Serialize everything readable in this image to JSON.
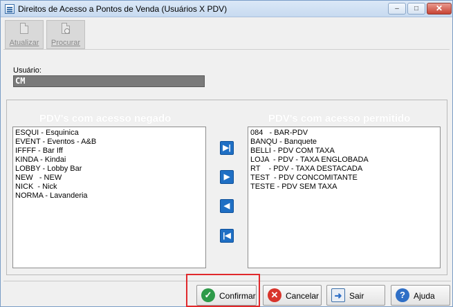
{
  "window": {
    "title": "Direitos de Acesso a Pontos de Venda  (Usuários X PDV)",
    "minimize": "‒",
    "maximize": "□",
    "close": "✕"
  },
  "toolbar": {
    "atualizar_label": "Atualizar",
    "procurar_label": "Procurar"
  },
  "user": {
    "label": "Usuário:",
    "value": "CM"
  },
  "denied": {
    "title": "PDV's com acesso negado",
    "items": [
      "ESQUI - Esquinica",
      "EVENT - Eventos - A&B",
      "IFFFF - Bar Iff",
      "KINDA - Kindai",
      "LOBBY - Lobby Bar",
      "NEW   - NEW",
      "NICK  - Nick",
      "NORMA - Lavanderia"
    ]
  },
  "allowed": {
    "title": "PDV's com acesso permitido",
    "items": [
      "084   - BAR-PDV",
      "BANQU - Banquete",
      "BELLI - PDV COM TAXA",
      "LOJA  - PDV - TAXA ENGLOBADA",
      "RT    - PDV - TAXA DESTACADA",
      "TEST  - PDV CONCOMITANTE",
      "TESTE - PDV SEM TAXA"
    ]
  },
  "transfer": {
    "move_all_right": "▶|",
    "move_right": "▶",
    "move_left": "◀",
    "move_all_left": "|◀"
  },
  "footer": {
    "confirmar": "Confirmar",
    "cancelar": "Cancelar",
    "sair": "Sair",
    "ajuda": "Ajuda"
  },
  "colors": {
    "arrow_blue": "#1f6fc4",
    "highlight_red": "#e0282b",
    "confirm_green": "#2e9a49",
    "cancel_red": "#d8342b"
  }
}
